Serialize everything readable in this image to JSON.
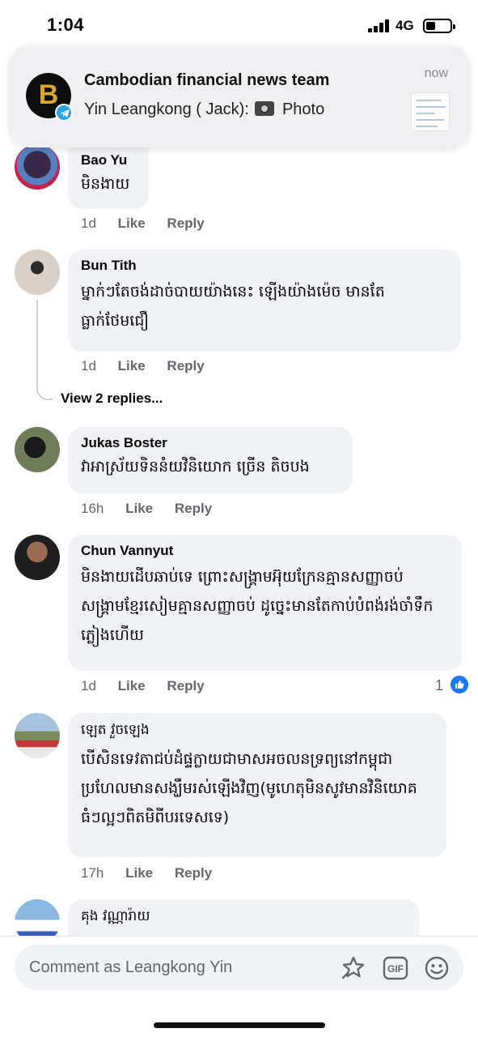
{
  "status_bar": {
    "time": "1:04",
    "network": "4G"
  },
  "notification": {
    "title": "Cambodian financial news team",
    "body_sender": "Yin Leangkong ( Jack):",
    "body_media": "Photo",
    "time": "now",
    "app_letter": "B"
  },
  "comments": [
    {
      "author": "Bao Yu",
      "text": "មិនងាយ",
      "time": "1d",
      "like": "Like",
      "reply": "Reply"
    },
    {
      "author": "Bun Tith",
      "text": "ម្នាក់ៗតែចង់ដាច់បាយយ៉ាងនេះ ឡើងយ៉ាងម៉េច មានតែធ្លាក់ថែមជឿ",
      "time": "1d",
      "like": "Like",
      "reply": "Reply",
      "view_replies": "View 2 replies..."
    },
    {
      "author": "Jukas Boster",
      "text": "វាអាស្រ័យទិននំយវិនិយោក ច្រើន តិចបង",
      "time": "16h",
      "like": "Like",
      "reply": "Reply"
    },
    {
      "author": "Chun Vannyut",
      "text": "មិនងាយដើបឆាប់ទេ ព្រោះសង្គ្រាមអ៊ុយក្រែនគ្មានសញ្ញាចប់ សង្គ្រាមខ្មែរសៀមគ្មានសញ្ញាចប់ ដូច្នេះមានតែកាប់បំពង់រង់ចាំទឹកភ្លៀងហើយ",
      "time": "1d",
      "like": "Like",
      "reply": "Reply",
      "reaction_count": "1"
    },
    {
      "author": "ឡេត វួចឡេង",
      "text": "បើសិនទេវតាជប់ដំផ្ទក្លាយជាមាសអចលនទ្រព្យនៅកម្ពុជាប្រហែលមានសង្ឃឹមរស់ឡើងវិញ(មូហេតុមិនសូវមានវិនិយោគធំៗល្អៗពិតមិពីបរទេសទេ)",
      "time": "17h",
      "like": "Like",
      "reply": "Reply"
    },
    {
      "author": "គុង វណ្ណារ៉ាយ"
    }
  ],
  "composer": {
    "placeholder": "Comment as Leangkong Yin"
  },
  "colors": {
    "accent": "#1877f2",
    "bubble": "#f0f2f5",
    "muted": "#65676b",
    "telegram": "#2aa3df"
  },
  "icons": [
    "signal-icon",
    "battery-icon",
    "telegram-badge-icon",
    "camera-icon",
    "like-reaction-icon",
    "sticker-icon",
    "gif-icon",
    "emoji-icon"
  ]
}
